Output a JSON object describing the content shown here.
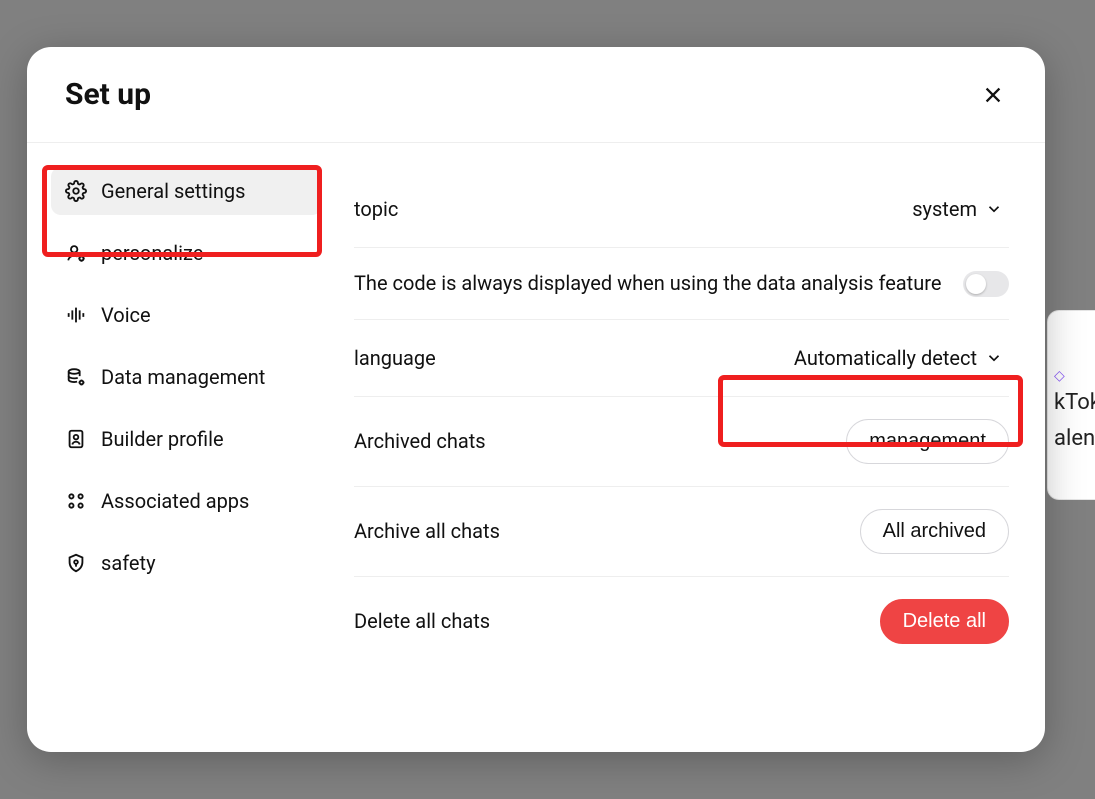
{
  "backgroundSnippet": {
    "line1": "kTok",
    "line2": "alend"
  },
  "modal": {
    "title": "Set up",
    "sidebar": [
      {
        "key": "general",
        "label": "General settings",
        "active": true
      },
      {
        "key": "personalize",
        "label": "personalize",
        "active": false
      },
      {
        "key": "voice",
        "label": "Voice",
        "active": false
      },
      {
        "key": "data",
        "label": "Data management",
        "active": false
      },
      {
        "key": "builder",
        "label": "Builder profile",
        "active": false
      },
      {
        "key": "apps",
        "label": "Associated apps",
        "active": false
      },
      {
        "key": "safety",
        "label": "safety",
        "active": false
      }
    ],
    "settings": {
      "topic": {
        "label": "topic",
        "value": "system"
      },
      "codeDisplay": {
        "label": "The code is always displayed when using the data analysis feature",
        "enabled": false
      },
      "language": {
        "label": "language",
        "value": "Automatically detect"
      },
      "archived": {
        "label": "Archived chats",
        "button": "management"
      },
      "archiveAll": {
        "label": "Archive all chats",
        "button": "All archived"
      },
      "deleteAll": {
        "label": "Delete all chats",
        "button": "Delete all"
      }
    }
  }
}
